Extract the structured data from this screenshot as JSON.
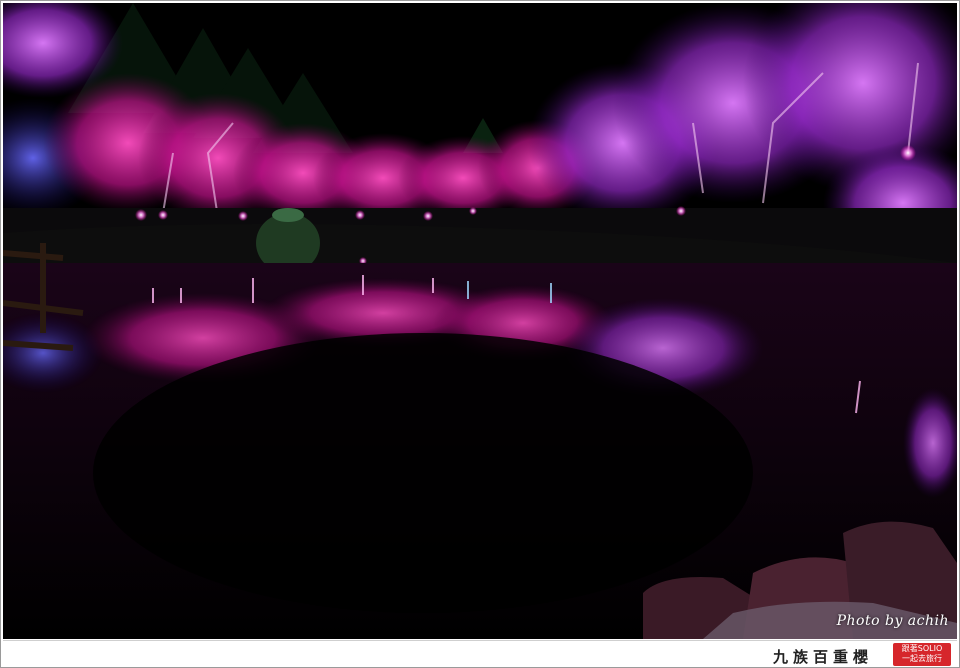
{
  "photo": {
    "subject": "",
    "credit": "Photo by achih"
  },
  "caption": {
    "title": "九族百重櫻"
  },
  "stamp": {
    "line1": "跟著SOLIO",
    "line2": "一起去旅行"
  },
  "colors": {
    "blossom_magenta": "#e0208c",
    "blossom_violet": "#b03cdc",
    "night": "#000000",
    "stamp_red": "#d6262b"
  }
}
